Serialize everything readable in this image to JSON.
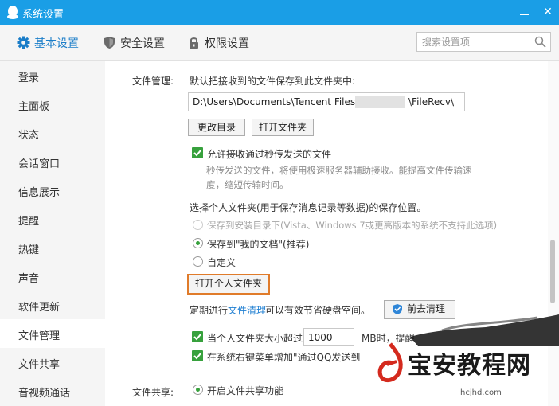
{
  "window": {
    "title": "系统设置",
    "min_icon": "minimize-icon",
    "close_glyph": "✕"
  },
  "tabs": [
    {
      "label": "基本设置",
      "icon": "gear-icon",
      "active": true
    },
    {
      "label": "安全设置",
      "icon": "shield-icon",
      "active": false
    },
    {
      "label": "权限设置",
      "icon": "lock-icon",
      "active": false
    }
  ],
  "search": {
    "placeholder": "搜索设置项",
    "icon": "search-icon"
  },
  "sidebar": {
    "items": [
      {
        "label": "登录"
      },
      {
        "label": "主面板"
      },
      {
        "label": "状态"
      },
      {
        "label": "会话窗口"
      },
      {
        "label": "信息展示"
      },
      {
        "label": "提醒"
      },
      {
        "label": "热键"
      },
      {
        "label": "声音"
      },
      {
        "label": "软件更新"
      },
      {
        "label": "文件管理",
        "active": true
      },
      {
        "label": "文件共享"
      },
      {
        "label": "音视频通话"
      }
    ]
  },
  "file_mgmt": {
    "label": "文件管理:",
    "save_desc": "默认把接收到的文件保存到此文件夹中:",
    "path_prefix": "D:\\Users\\Documents\\Tencent Files\\",
    "path_suffix": "\\FileRecv\\",
    "change_dir_btn": "更改目录",
    "open_folder_btn": "打开文件夹",
    "allow_flash": {
      "label": "允许接收通过秒传发送的文件",
      "checked": true
    },
    "flash_desc_1": "秒传发送的文件，将使用极速服务器辅助接收。能提高文件传输速",
    "flash_desc_2": "度，缩短传输时间。",
    "personal_folder_desc": "选择个人文件夹(用于保存消息记录等数据)的保存位置。",
    "radio_install": "保存到安装目录下(Vista、Windows 7或更高版本的系统不支持此选项)",
    "radio_mydocs": "保存到\"我的文档\"(推荐)",
    "radio_custom": "自定义",
    "open_personal_btn": "打开个人文件夹",
    "clean_prefix": "定期进行",
    "clean_link": "文件清理",
    "clean_suffix": "可以有效节省硬盘空间。",
    "clean_btn": "前去清理",
    "size_limit_prefix": "当个人文件夹大小超过",
    "size_limit_value": "1000",
    "size_limit_suffix": "MB时，提醒",
    "context_menu_label": "在系统右键菜单增加\"通过QQ发送到"
  },
  "file_share": {
    "label": "文件共享:",
    "enable_label": "开启文件共享功能"
  },
  "watermark": {
    "brand": "宝安教程网",
    "url": "hcjhd.com"
  }
}
